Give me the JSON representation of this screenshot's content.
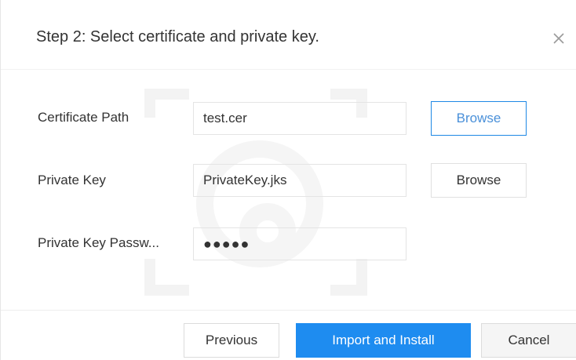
{
  "dialog": {
    "title": "Step 2: Select certificate and private key.",
    "close_icon": "close-icon"
  },
  "form": {
    "certificate_path": {
      "label": "Certificate Path",
      "value": "test.cer",
      "browse_label": "Browse"
    },
    "private_key": {
      "label": "Private Key",
      "value": "PrivateKey.jks",
      "browse_label": "Browse"
    },
    "private_key_password": {
      "label": "Private Key Passw...",
      "value": "●●●●●"
    }
  },
  "footer": {
    "previous_label": "Previous",
    "import_label": "Import and Install",
    "cancel_label": "Cancel"
  },
  "colors": {
    "primary": "#1e8cf0",
    "active_border": "#1e88e5",
    "text": "#333333"
  }
}
